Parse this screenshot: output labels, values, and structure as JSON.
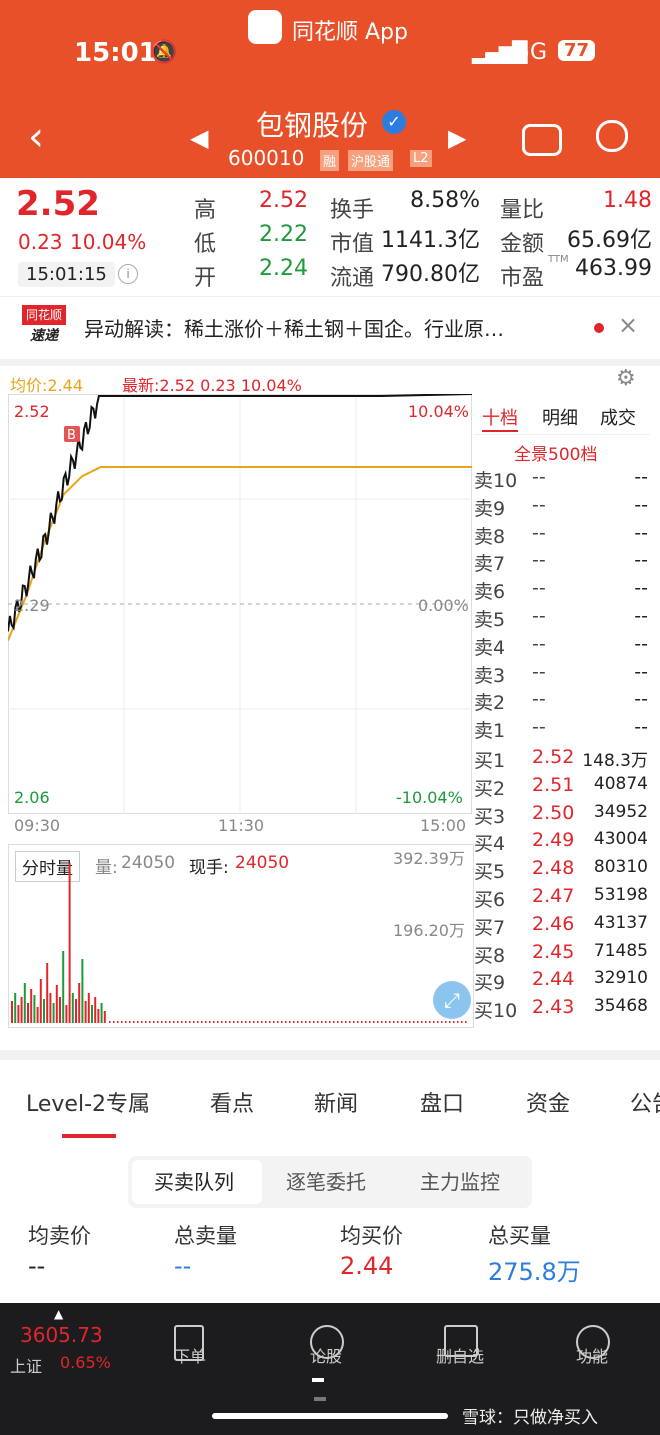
{
  "status": {
    "time": "15:01",
    "app_badge": "同花顺 App",
    "network": "5G",
    "battery": "77"
  },
  "header": {
    "name": "包钢股份",
    "code": "600010",
    "tags": [
      "融",
      "沪股通",
      "L2"
    ]
  },
  "quote": {
    "price": "2.52",
    "change": "0.23",
    "pct": "10.04%",
    "time": "15:01:15",
    "labels": {
      "high": "高",
      "low": "低",
      "open": "开",
      "turnover": "换手",
      "mcap": "市值",
      "float": "流通",
      "vr": "量比",
      "amount": "金额",
      "pe": "市盈",
      "ttm": "TTM"
    },
    "values": {
      "high": "2.52",
      "low": "2.22",
      "open": "2.24",
      "turnover": "8.58%",
      "mcap": "1141.3亿",
      "float": "790.80亿",
      "vr": "1.48",
      "amount": "65.69亿",
      "pe": "463.99"
    }
  },
  "news": {
    "logo_top": "同花顺",
    "logo_bottom": "速递",
    "text": "异动解读：稀土涨价＋稀土钢＋国企。行业原…"
  },
  "chart": {
    "avg_label": "均价:2.44",
    "latest_label": "最新:2.52  0.23  10.04%",
    "top_price": "2.52",
    "top_pct": "10.04%",
    "mid_price": "2.29",
    "mid_pct": "0.00%",
    "bot_price": "2.06",
    "bot_pct": "-10.04%",
    "times": [
      "09:30",
      "11:30",
      "15:00"
    ],
    "b_marker": "B",
    "vol_tab": "分时量",
    "vol_label": "量:",
    "vol_value": "24050",
    "hand_label": "现手:",
    "hand_value": "24050",
    "vol_max": "392.39万",
    "vol_mid": "196.20万"
  },
  "chart_data": {
    "type": "line",
    "title": "",
    "x": [
      "09:30",
      "11:30",
      "15:00"
    ],
    "ylim": [
      2.06,
      2.52
    ],
    "series": [
      {
        "name": "最新",
        "values": [
          2.26,
          2.31,
          2.36,
          2.42,
          2.47,
          2.52,
          2.52,
          2.52
        ]
      },
      {
        "name": "均价",
        "values": [
          2.25,
          2.3,
          2.36,
          2.41,
          2.43,
          2.44,
          2.44,
          2.44
        ]
      }
    ]
  },
  "orderbook": {
    "tabs": [
      "十档",
      "明细",
      "成交"
    ],
    "full_label": "全景500档",
    "sell": [
      {
        "label": "卖10",
        "price": "--",
        "vol": "--"
      },
      {
        "label": "卖9",
        "price": "--",
        "vol": "--"
      },
      {
        "label": "卖8",
        "price": "--",
        "vol": "--"
      },
      {
        "label": "卖7",
        "price": "--",
        "vol": "--"
      },
      {
        "label": "卖6",
        "price": "--",
        "vol": "--"
      },
      {
        "label": "卖5",
        "price": "--",
        "vol": "--"
      },
      {
        "label": "卖4",
        "price": "--",
        "vol": "--"
      },
      {
        "label": "卖3",
        "price": "--",
        "vol": "--"
      },
      {
        "label": "卖2",
        "price": "--",
        "vol": "--"
      },
      {
        "label": "卖1",
        "price": "--",
        "vol": "--"
      }
    ],
    "buy": [
      {
        "label": "买1",
        "price": "2.52",
        "vol": "148.3万"
      },
      {
        "label": "买2",
        "price": "2.51",
        "vol": "40874"
      },
      {
        "label": "买3",
        "price": "2.50",
        "vol": "34952"
      },
      {
        "label": "买4",
        "price": "2.49",
        "vol": "43004"
      },
      {
        "label": "买5",
        "price": "2.48",
        "vol": "80310"
      },
      {
        "label": "买6",
        "price": "2.47",
        "vol": "53198"
      },
      {
        "label": "买7",
        "price": "2.46",
        "vol": "43137"
      },
      {
        "label": "买8",
        "price": "2.45",
        "vol": "71485"
      },
      {
        "label": "买9",
        "price": "2.44",
        "vol": "32910"
      },
      {
        "label": "买10",
        "price": "2.43",
        "vol": "35468"
      }
    ]
  },
  "tabs": [
    "Level-2专属",
    "看点",
    "新闻",
    "盘口",
    "资金",
    "公告"
  ],
  "segmented": [
    "买卖队列",
    "逐笔委托",
    "主力监控"
  ],
  "summary": {
    "labels": [
      "均卖价",
      "总卖量",
      "均买价",
      "总买量"
    ],
    "values": [
      "--",
      "--",
      "2.44",
      "275.8万"
    ]
  },
  "nav": {
    "index_value": "3605.73",
    "index_name": "上证",
    "index_pct": "0.65%",
    "items": [
      "下单",
      "论股",
      "删自选",
      "功能"
    ],
    "watermark": "雪球：只做净买入"
  }
}
